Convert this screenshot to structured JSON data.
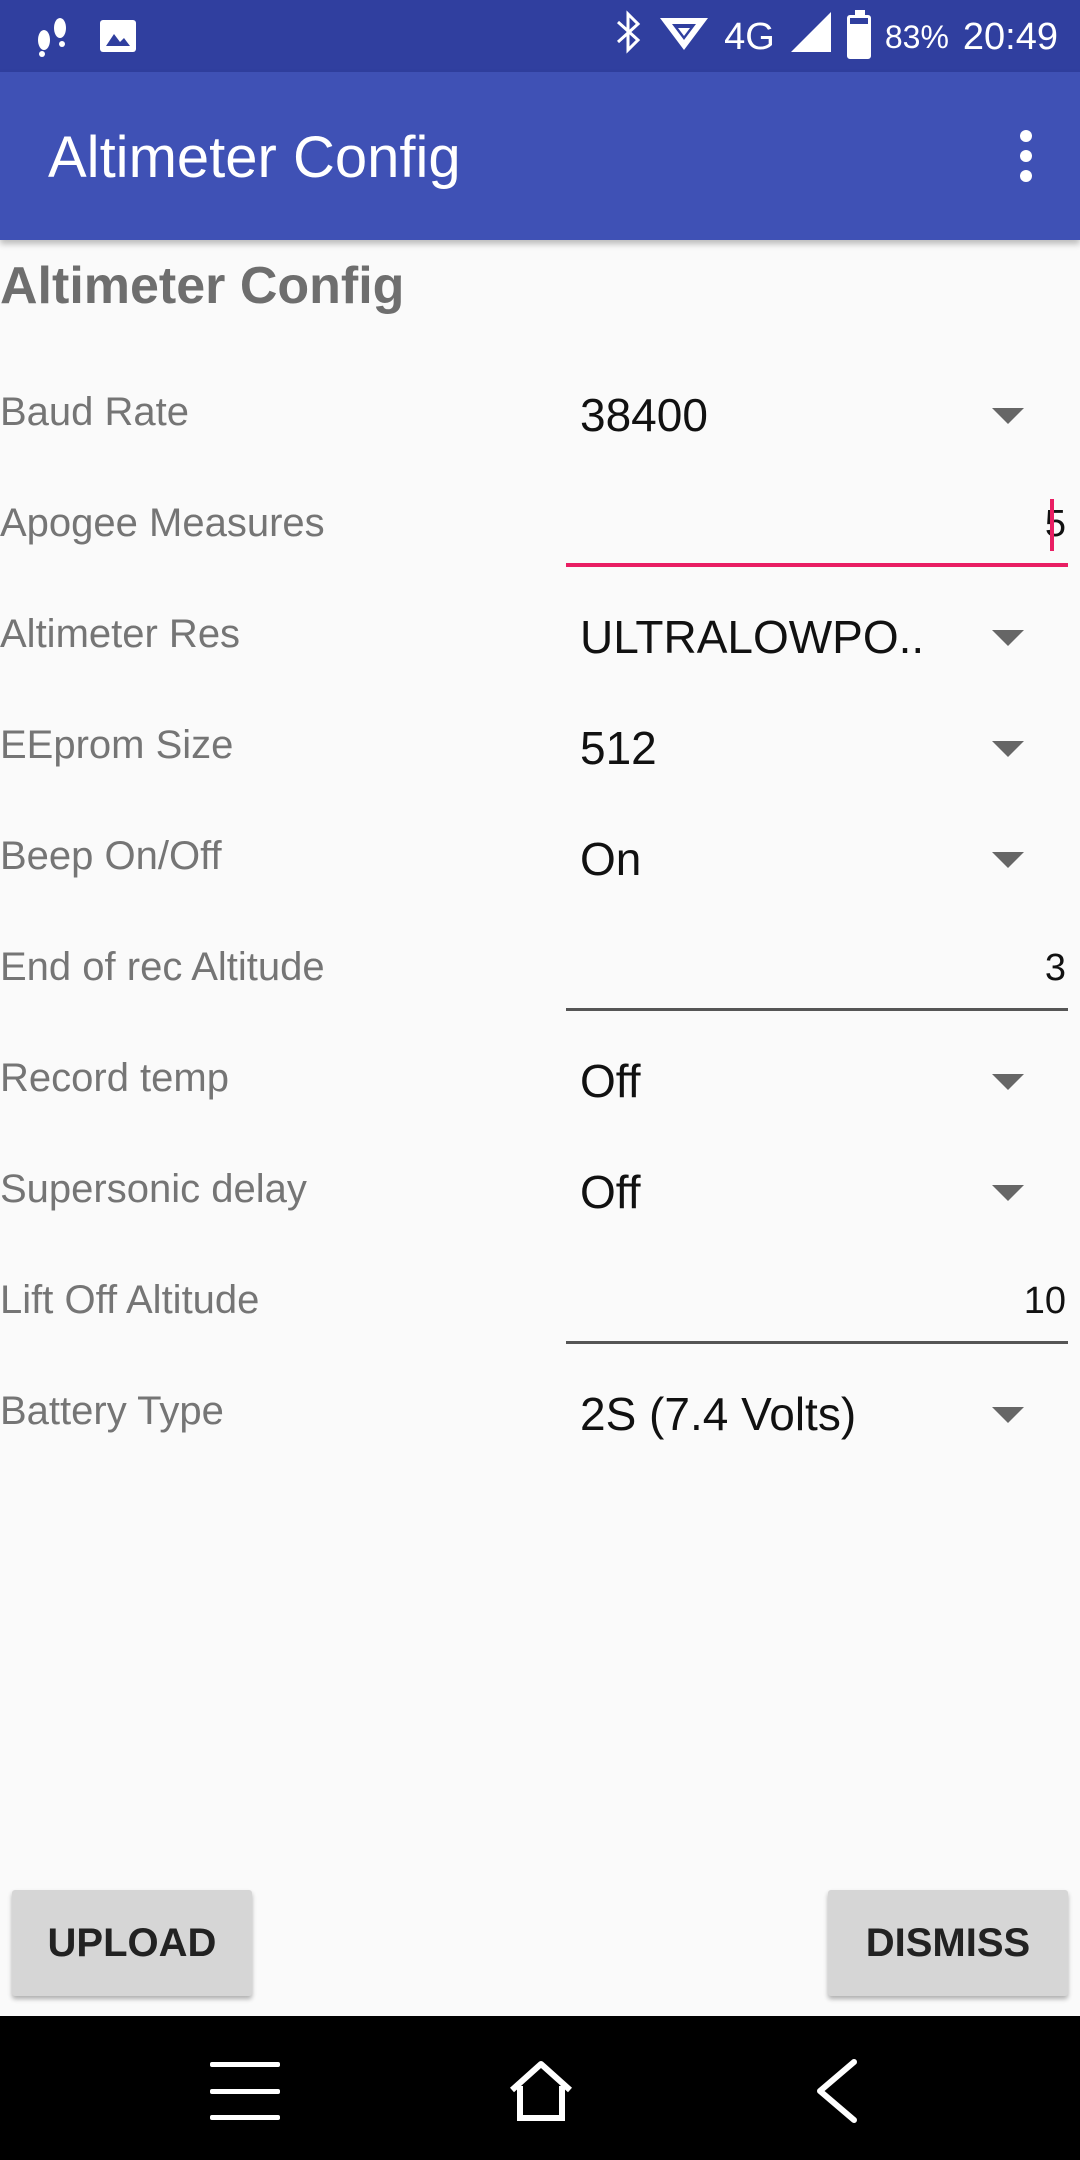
{
  "status_bar": {
    "battery_percent": "83%",
    "battery_level": 0.83,
    "network": "4G",
    "time": "20:49",
    "icons": [
      "footsteps-icon",
      "image-icon",
      "bluetooth-icon",
      "wifi-icon",
      "signal-icon",
      "battery-icon"
    ]
  },
  "app_bar": {
    "title": "Altimeter Config",
    "overflow_icon": "more-vert-icon"
  },
  "form": {
    "section_title": "Altimeter Config",
    "rows": [
      {
        "label": "Baud Rate",
        "type": "spinner",
        "value": "38400"
      },
      {
        "label": "Apogee Measures",
        "type": "edit",
        "value": "5",
        "focused": true
      },
      {
        "label": "Altimeter Res",
        "type": "spinner",
        "value": "ULTRALOWPO.."
      },
      {
        "label": "EEprom Size",
        "type": "spinner",
        "value": "512"
      },
      {
        "label": "Beep On/Off",
        "type": "spinner",
        "value": "On"
      },
      {
        "label": "End of rec Altitude",
        "type": "edit",
        "value": "3"
      },
      {
        "label": "Record temp",
        "type": "spinner",
        "value": "Off"
      },
      {
        "label": "Supersonic delay",
        "type": "spinner",
        "value": "Off"
      },
      {
        "label": "Lift Off Altitude",
        "type": "edit",
        "value": "10"
      },
      {
        "label": "Battery Type",
        "type": "spinner",
        "value": "2S (7.4 Volts)"
      }
    ]
  },
  "buttons": {
    "upload": "UPLOAD",
    "dismiss": "DISMISS"
  },
  "colors": {
    "status_bar": "#303f9f",
    "app_bar": "#3f51b5",
    "accent": "#e91e63"
  }
}
